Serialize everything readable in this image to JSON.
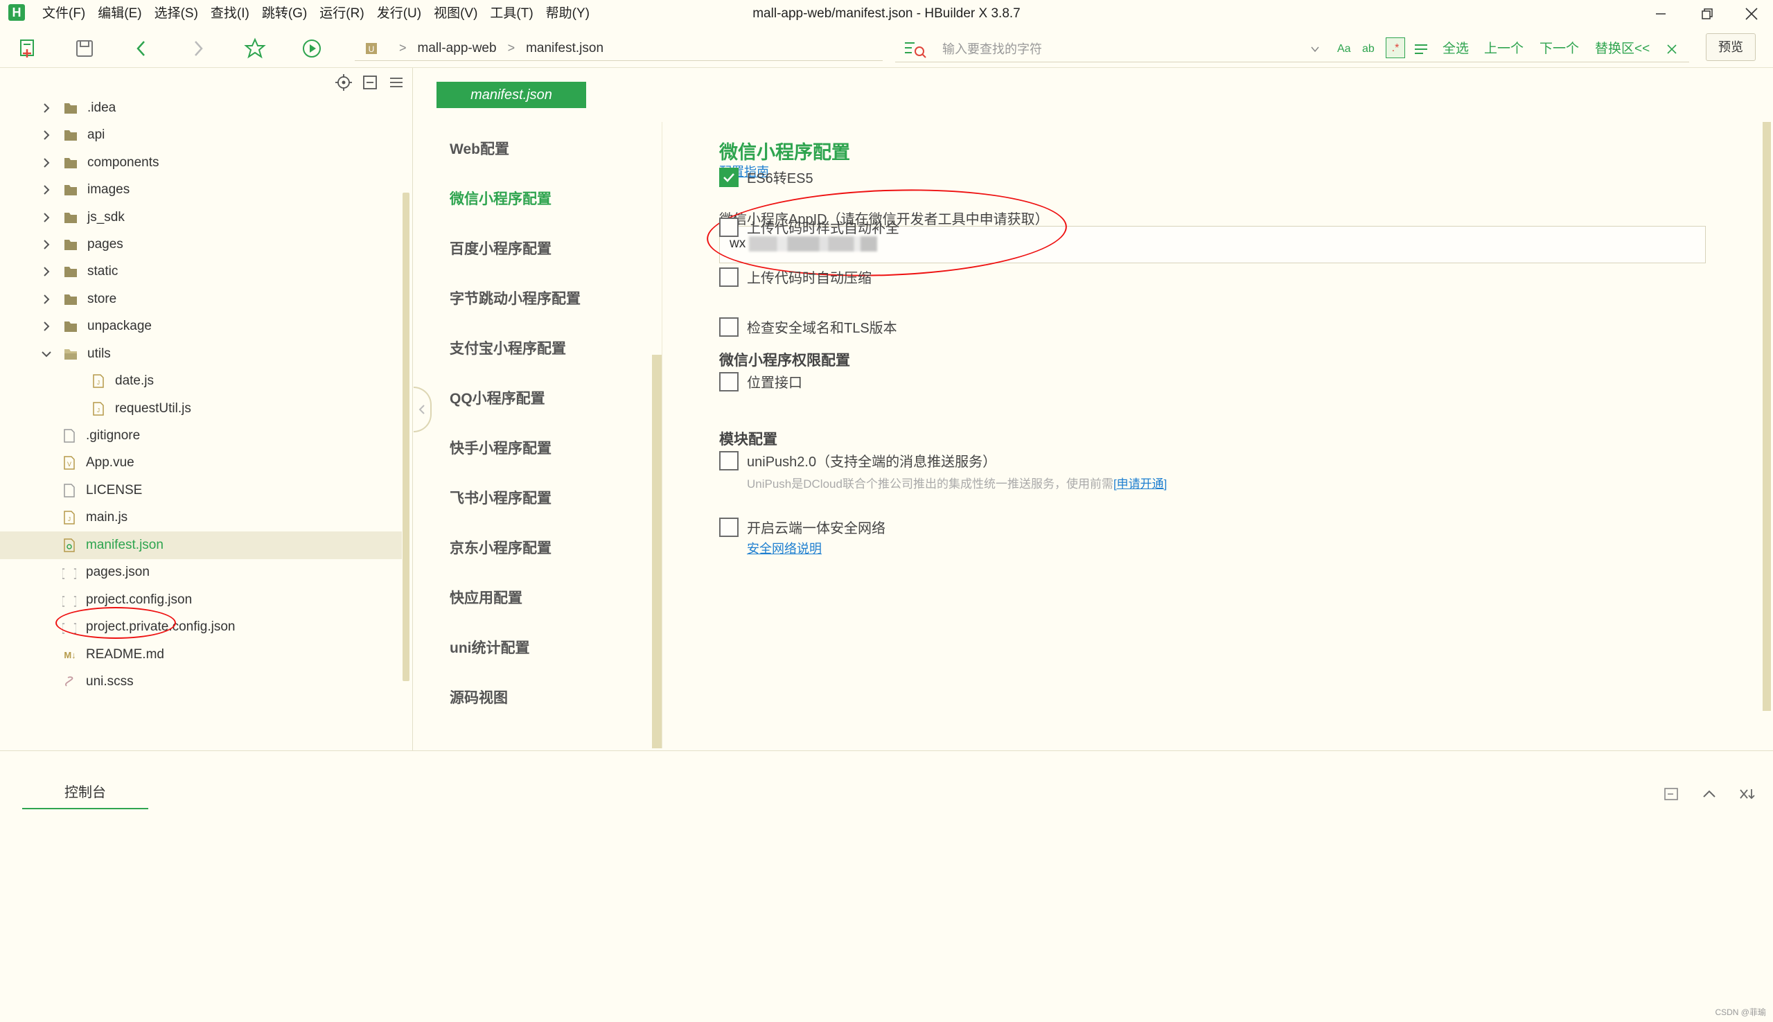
{
  "window": {
    "title": "mall-app-web/manifest.json - HBuilder X 3.8.7",
    "logo": "H"
  },
  "menu": [
    "文件(F)",
    "编辑(E)",
    "选择(S)",
    "查找(I)",
    "跳转(G)",
    "运行(R)",
    "发行(U)",
    "视图(V)",
    "工具(T)",
    "帮助(Y)"
  ],
  "toolbar": {
    "breadcrumb": [
      "mall-app-web",
      "manifest.json"
    ],
    "search_placeholder": "输入要查找的字符",
    "search_actions": [
      "全选",
      "上一个",
      "下一个",
      "替换区<<"
    ],
    "preview_label": "预览"
  },
  "explorer": {
    "items": [
      {
        "label": ".idea",
        "type": "folder",
        "expanded": false
      },
      {
        "label": "api",
        "type": "folder",
        "expanded": false
      },
      {
        "label": "components",
        "type": "folder",
        "expanded": false
      },
      {
        "label": "images",
        "type": "folder",
        "expanded": false
      },
      {
        "label": "js_sdk",
        "type": "folder",
        "expanded": false
      },
      {
        "label": "pages",
        "type": "folder",
        "expanded": false
      },
      {
        "label": "static",
        "type": "folder",
        "expanded": false
      },
      {
        "label": "store",
        "type": "folder",
        "expanded": false
      },
      {
        "label": "unpackage",
        "type": "folder",
        "expanded": false
      },
      {
        "label": "utils",
        "type": "folder",
        "expanded": true
      },
      {
        "label": "date.js",
        "type": "js"
      },
      {
        "label": "requestUtil.js",
        "type": "js"
      },
      {
        "label": ".gitignore",
        "type": "file"
      },
      {
        "label": "App.vue",
        "type": "vue"
      },
      {
        "label": "LICENSE",
        "type": "file"
      },
      {
        "label": "main.js",
        "type": "js"
      },
      {
        "label": "manifest.json",
        "type": "manifest",
        "selected": true
      },
      {
        "label": "pages.json",
        "type": "json"
      },
      {
        "label": "project.config.json",
        "type": "json"
      },
      {
        "label": "project.private.config.json",
        "type": "json"
      },
      {
        "label": "README.md",
        "type": "md"
      },
      {
        "label": "uni.scss",
        "type": "scss"
      }
    ]
  },
  "editor": {
    "tab_label": "manifest.json",
    "nav": [
      "Web配置",
      "微信小程序配置",
      "百度小程序配置",
      "字节跳动小程序配置",
      "支付宝小程序配置",
      "QQ小程序配置",
      "快手小程序配置",
      "飞书小程序配置",
      "京东小程序配置",
      "快应用配置",
      "uni统计配置",
      "源码视图"
    ],
    "active_nav": "微信小程序配置",
    "section_title": "微信小程序配置",
    "guide_link": "配置指南",
    "appid": {
      "label": "微信小程序AppID（请在微信开发者工具中申请获取）",
      "value_prefix": "wx"
    },
    "options": [
      {
        "label": "ES6转ES5",
        "checked": true
      },
      {
        "label": "上传代码时样式自动补全",
        "checked": false
      },
      {
        "label": "上传代码时自动压缩",
        "checked": false
      },
      {
        "label": "检查安全域名和TLS版本",
        "checked": false
      }
    ],
    "permission_title": "微信小程序权限配置",
    "permission_option": {
      "label": "位置接口",
      "checked": false
    },
    "module_title": "模块配置",
    "unipush": {
      "label": "uniPush2.0（支持全端的消息推送服务）",
      "checked": false,
      "hint": "UniPush是DCloud联合个推公司推出的集成性统一推送服务，使用前需",
      "hint_link": "[申请开通]"
    },
    "secure_network": {
      "label": "开启云端一体安全网络",
      "checked": false,
      "link": "安全网络说明"
    }
  },
  "console": {
    "tab_label": "控制台"
  },
  "watermark": "CSDN @菲瑜",
  "colors": {
    "accent": "#2ea44f",
    "background": "#fffdf3",
    "link": "#1e7fd0",
    "annotation": "#ee1111"
  }
}
